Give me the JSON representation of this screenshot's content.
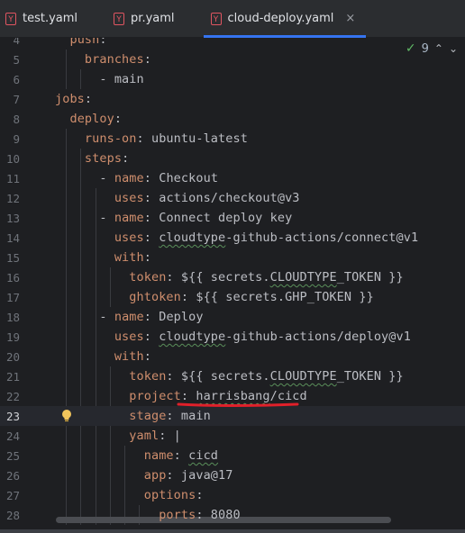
{
  "tabs": [
    {
      "label": "test.yaml",
      "icon": "yaml-file-icon",
      "active": false
    },
    {
      "label": "pr.yaml",
      "icon": "yaml-file-icon",
      "active": false
    },
    {
      "label": "cloud-deploy.yaml",
      "icon": "yaml-file-icon",
      "active": true
    }
  ],
  "tab_icon_letter": "Y",
  "close_glyph": "×",
  "inspection": {
    "count": "9",
    "check_glyph": "✓",
    "up_glyph": "⌃",
    "down_glyph": "⌄"
  },
  "lines": [
    {
      "n": "4",
      "text": "  push:"
    },
    {
      "n": "5",
      "text": "    branches:"
    },
    {
      "n": "6",
      "text": "      - main"
    },
    {
      "n": "7",
      "text": "jobs:"
    },
    {
      "n": "8",
      "text": "  deploy:"
    },
    {
      "n": "9",
      "text": "    runs-on: ubuntu-latest"
    },
    {
      "n": "10",
      "text": "    steps:"
    },
    {
      "n": "11",
      "text": "      - name: Checkout"
    },
    {
      "n": "12",
      "text": "        uses: actions/checkout@v3"
    },
    {
      "n": "13",
      "text": "      - name: Connect deploy key"
    },
    {
      "n": "14",
      "text": "        uses: cloudtype-github-actions/connect@v1"
    },
    {
      "n": "15",
      "text": "        with:"
    },
    {
      "n": "16",
      "text": "          token: ${{ secrets.CLOUDTYPE_TOKEN }}"
    },
    {
      "n": "17",
      "text": "          ghtoken: ${{ secrets.GHP_TOKEN }}"
    },
    {
      "n": "18",
      "text": "      - name: Deploy"
    },
    {
      "n": "19",
      "text": "        uses: cloudtype-github-actions/deploy@v1"
    },
    {
      "n": "20",
      "text": "        with:"
    },
    {
      "n": "21",
      "text": "          token: ${{ secrets.CLOUDTYPE_TOKEN }}"
    },
    {
      "n": "22",
      "text": "          project: harrisbang/cicd"
    },
    {
      "n": "23",
      "text": "          stage: main"
    },
    {
      "n": "24",
      "text": "          yaml: |"
    },
    {
      "n": "25",
      "text": "            name: cicd"
    },
    {
      "n": "26",
      "text": "            app: java@17"
    },
    {
      "n": "27",
      "text": "            options:"
    },
    {
      "n": "28",
      "text": "              ports: 8080"
    }
  ],
  "current_line": "23",
  "colors": {
    "key": "#cf8e6d",
    "text": "#bcbec4",
    "accent": "#3574f0",
    "annotation": "#e0202a"
  }
}
